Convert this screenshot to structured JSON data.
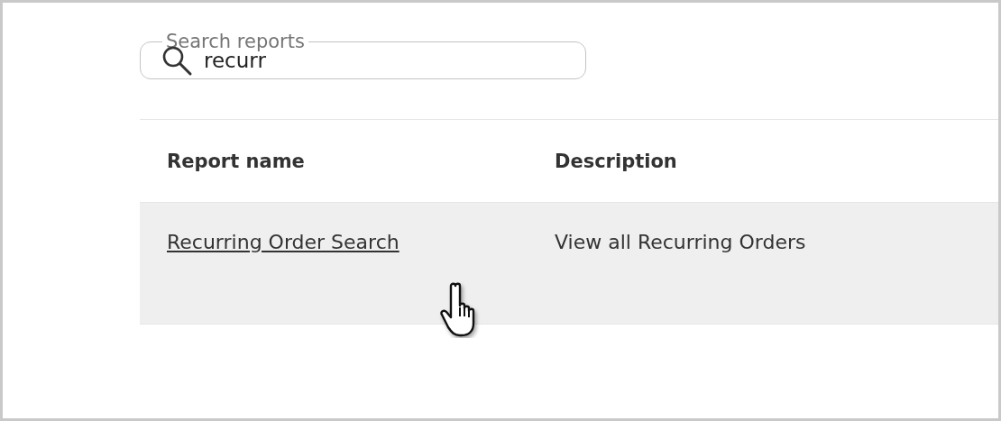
{
  "search": {
    "label": "Search reports",
    "value": "recurr"
  },
  "table": {
    "columns": [
      "Report name",
      "Description"
    ],
    "rows": [
      {
        "report_name": "Recurring Order Search",
        "description": "View all Recurring Orders",
        "hovered": true
      }
    ]
  }
}
